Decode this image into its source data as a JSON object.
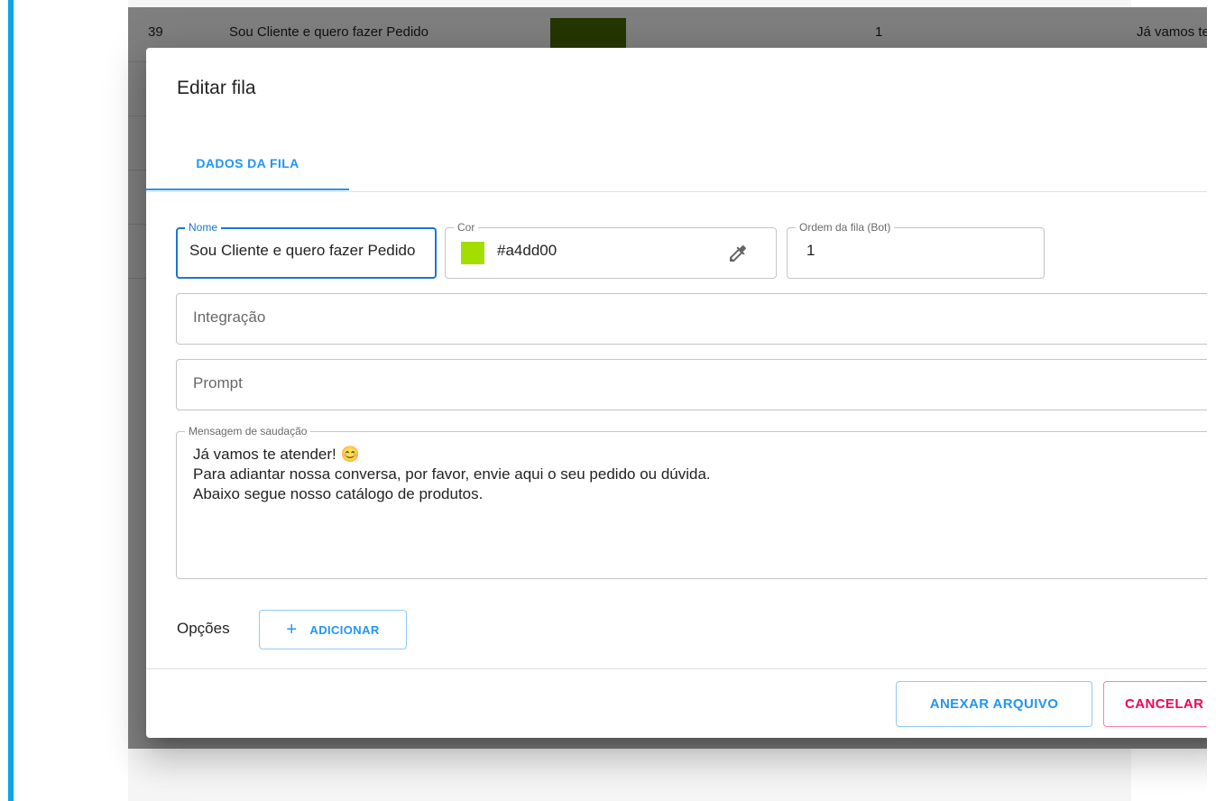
{
  "background_row": {
    "id": "39",
    "name": "Sou Cliente e quero fazer Pedido",
    "color": "#4a6d00",
    "order": "1",
    "greeting_preview": "Já vamos te atender!"
  },
  "dialog": {
    "title": "Editar fila",
    "tab_label": "DADOS DA FILA",
    "fields": {
      "nome": {
        "label": "Nome",
        "value": "Sou Cliente e quero fazer Pedido"
      },
      "cor": {
        "label": "Cor",
        "value": "#a4dd00",
        "swatch": "#a4dd00",
        "icon": "eyedropper-icon"
      },
      "ordem": {
        "label": "Ordem da fila (Bot)",
        "value": "1"
      },
      "integracao": {
        "placeholder": "Integração"
      },
      "prompt": {
        "placeholder": "Prompt"
      },
      "mensagem": {
        "label": "Mensagem de saudação",
        "lines": [
          "Já vamos te atender! 😊",
          "Para adiantar nossa conversa, por favor, envie aqui o seu pedido ou dúvida.",
          "Abaixo segue nosso catálogo de produtos."
        ]
      }
    },
    "options_label": "Opções",
    "add_button": "ADICIONAR",
    "attach_button": "ANEXAR ARQUIVO",
    "cancel_button": "CANCELAR"
  },
  "colors": {
    "primary": "#2196f3",
    "focus": "#1976d2",
    "secondary": "#f50057",
    "left_accent": "#0aa5e6"
  }
}
